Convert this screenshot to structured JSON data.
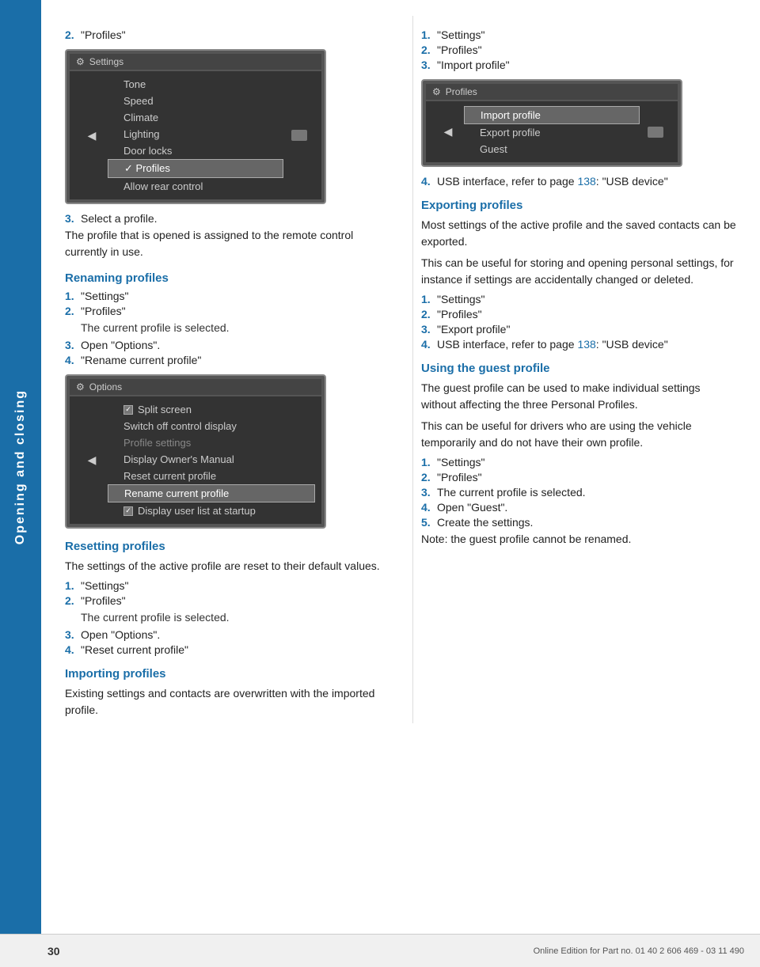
{
  "sidebar": {
    "label": "Opening and closing"
  },
  "left_column": {
    "item2_label": "\"Profiles\"",
    "item3_label": "Select a profile.",
    "body1": "The profile that is opened is assigned to the remote control currently in use.",
    "section1": {
      "heading": "Renaming profiles",
      "items": [
        {
          "num": "1.",
          "text": "\"Settings\""
        },
        {
          "num": "2.",
          "text": "\"Profiles\""
        },
        {
          "num": "",
          "text": "The current profile is selected.",
          "indent": true
        },
        {
          "num": "3.",
          "text": "Open \"Options\"."
        },
        {
          "num": "4.",
          "text": "\"Rename current profile\""
        }
      ]
    },
    "section2": {
      "heading": "Resetting profiles",
      "body": "The settings of the active profile are reset to their default values.",
      "items": [
        {
          "num": "1.",
          "text": "\"Settings\""
        },
        {
          "num": "2.",
          "text": "\"Profiles\""
        },
        {
          "num": "",
          "text": "The current profile is selected.",
          "indent": true
        },
        {
          "num": "3.",
          "text": "Open \"Options\"."
        },
        {
          "num": "4.",
          "text": "\"Reset current profile\""
        }
      ]
    },
    "section3": {
      "heading": "Importing profiles",
      "body": "Existing settings and contacts are overwritten with the imported profile.",
      "items": []
    }
  },
  "right_column": {
    "items_top": [
      {
        "num": "1.",
        "text": "\"Settings\""
      },
      {
        "num": "2.",
        "text": "\"Profiles\""
      },
      {
        "num": "3.",
        "text": "\"Import profile\""
      }
    ],
    "item4": "USB interface, refer to page",
    "item4_link": "138",
    "item4_suffix": ": \"USB device\"",
    "section_export": {
      "heading": "Exporting profiles",
      "body1": "Most settings of the active profile and the saved contacts can be exported.",
      "body2": "This can be useful for storing and opening personal settings, for instance if settings are accidentally changed or deleted.",
      "items": [
        {
          "num": "1.",
          "text": "\"Settings\""
        },
        {
          "num": "2.",
          "text": "\"Profiles\""
        },
        {
          "num": "3.",
          "text": "\"Export profile\""
        }
      ],
      "item4": "USB interface, refer to page",
      "item4_link": "138",
      "item4_suffix": ": \"USB device\""
    },
    "section_guest": {
      "heading": "Using the guest profile",
      "body1": "The guest profile can be used to make individual settings without affecting the three Personal Profiles.",
      "body2": "This can be useful for drivers who are using the vehicle temporarily and do not have their own profile.",
      "items": [
        {
          "num": "1.",
          "text": "\"Settings\""
        },
        {
          "num": "2.",
          "text": "\"Profiles\""
        },
        {
          "num": "3.",
          "text": "The current profile is selected."
        },
        {
          "num": "4.",
          "text": "Open \"Guest\"."
        },
        {
          "num": "5.",
          "text": "Create the settings."
        }
      ],
      "note": "Note: the guest profile cannot be renamed."
    }
  },
  "screens": {
    "settings_menu": {
      "title": "Settings",
      "items": [
        "Tone",
        "Speed",
        "Climate",
        "Lighting",
        "Door locks",
        "Profiles",
        "Allow rear control"
      ],
      "selected": "Profiles"
    },
    "options_menu": {
      "title": "Options",
      "items": [
        {
          "text": "Split screen",
          "type": "checkbox",
          "checked": true
        },
        {
          "text": "Switch off control display",
          "type": "normal"
        },
        {
          "text": "Profile settings",
          "type": "dimmed"
        },
        {
          "text": "Display Owner's Manual",
          "type": "normal"
        },
        {
          "text": "Reset current profile",
          "type": "normal"
        },
        {
          "text": "Rename current profile",
          "type": "highlighted"
        },
        {
          "text": "Display user list at startup",
          "type": "checkbox",
          "checked": true
        }
      ]
    },
    "profiles_menu": {
      "title": "Profiles",
      "items": [
        {
          "text": "Import profile",
          "type": "highlighted"
        },
        {
          "text": "Export profile",
          "type": "normal"
        },
        {
          "text": "Guest",
          "type": "normal"
        }
      ]
    }
  },
  "footer": {
    "page_number": "30",
    "text": "Online Edition for Part no. 01 40 2 606 469 - 03 11 490"
  }
}
